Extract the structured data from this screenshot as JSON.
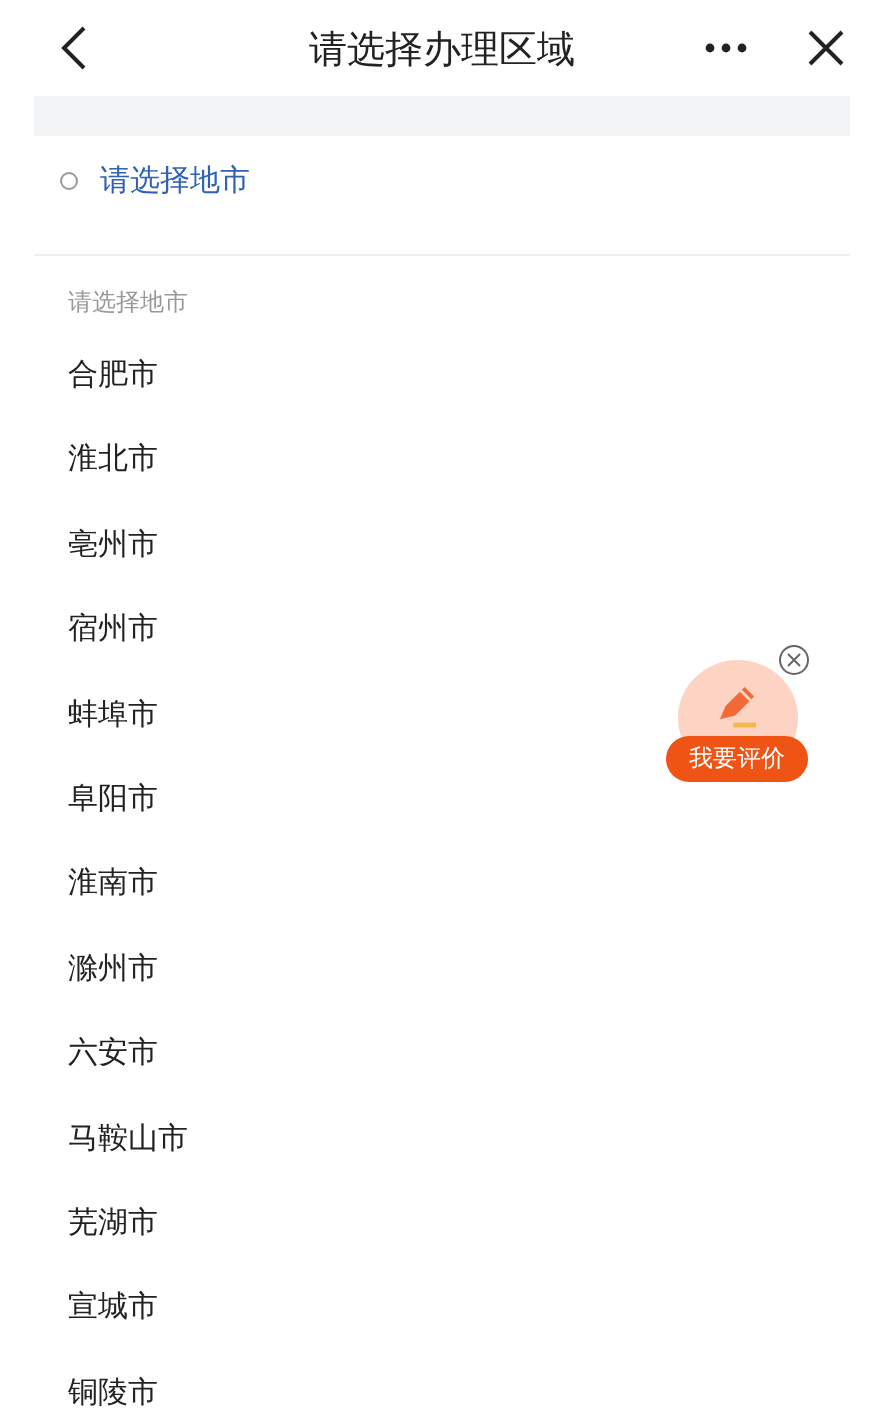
{
  "header": {
    "title": "请选择办理区域"
  },
  "steps": [
    {
      "label": "请选择地市",
      "selected": false
    }
  ],
  "list": {
    "heading": "请选择地市",
    "items": [
      {
        "label": "合肥市"
      },
      {
        "label": "淮北市"
      },
      {
        "label": "亳州市"
      },
      {
        "label": "宿州市"
      },
      {
        "label": "蚌埠市"
      },
      {
        "label": "阜阳市"
      },
      {
        "label": "淮南市"
      },
      {
        "label": "滁州市"
      },
      {
        "label": "六安市"
      },
      {
        "label": "马鞍山市"
      },
      {
        "label": "芜湖市"
      },
      {
        "label": "宣城市"
      },
      {
        "label": "铜陵市"
      }
    ]
  },
  "feedback": {
    "label": "我要评价"
  }
}
